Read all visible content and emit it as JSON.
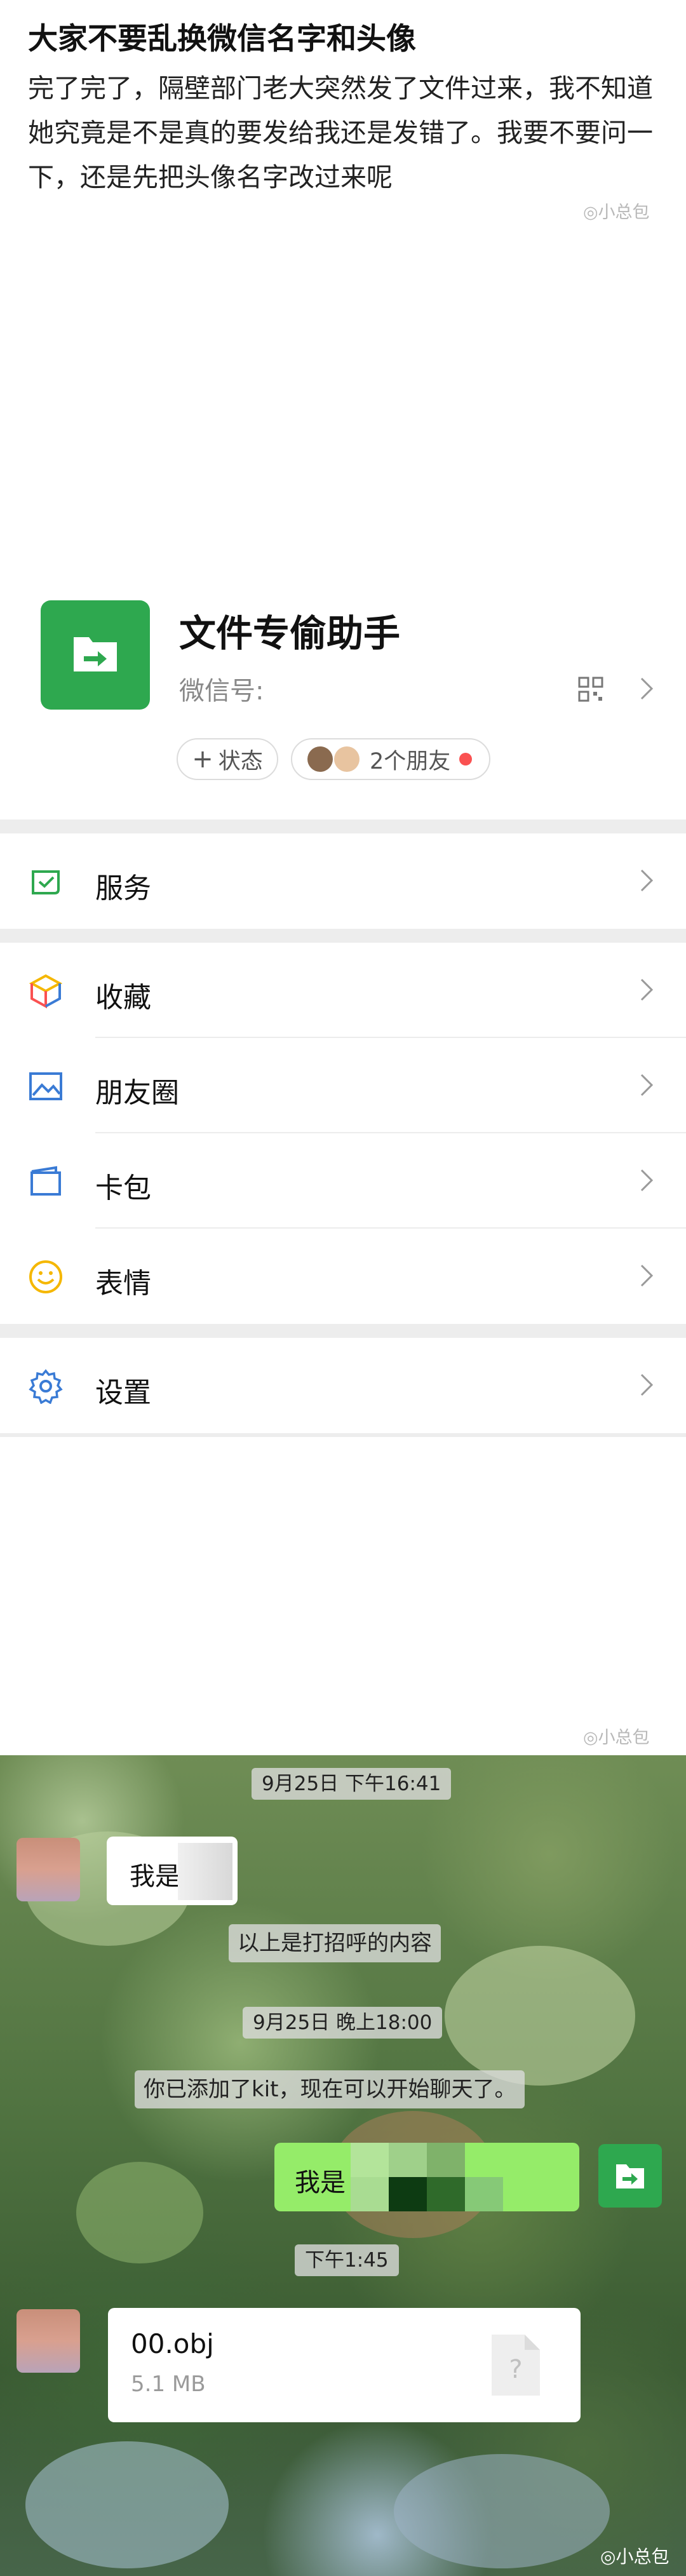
{
  "post": {
    "title": "大家不要乱换微信名字和头像",
    "body": "完了完了，隔壁部门老大突然发了文件过来，我不知道她究竟是不是真的要发给我还是发错了。我要不要问一下，还是先把头像名字改过来呢",
    "watermark": "小总包"
  },
  "profile": {
    "name": "文件专偷助手",
    "wechat_id_label": "微信号:",
    "wechat_id_value": "",
    "status_button": "状态",
    "friends_button": "2个朋友",
    "menu": {
      "services": "服务",
      "favorites": "收藏",
      "moments": "朋友圈",
      "cards": "卡包",
      "stickers": "表情",
      "settings": "设置"
    },
    "watermark": "小总包"
  },
  "chat": {
    "timestamp1": "9月25日 下午16:41",
    "msg_incoming1": "我是",
    "system1": "以上是打招呼的内容",
    "timestamp2": "9月25日 晚上18:00",
    "system2": "你已添加了kit，现在可以开始聊天了。",
    "msg_outgoing1": "我是",
    "timestamp3": "下午1:45",
    "file": {
      "name": "00.obj",
      "size": "5.1 MB"
    },
    "watermark": "小总包"
  },
  "colors": {
    "wechat_green": "#2ea84f",
    "bubble_green": "#95ec69",
    "divider_gray": "#ededed"
  }
}
